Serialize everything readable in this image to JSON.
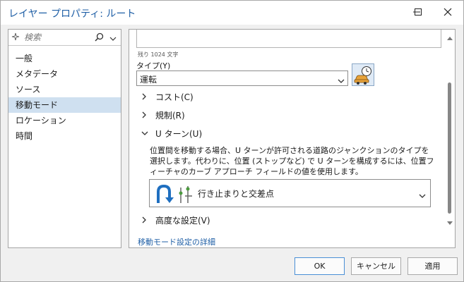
{
  "window": {
    "title": "レイヤー プロパティ: ルート"
  },
  "sidebar": {
    "search_placeholder": "検索",
    "items": [
      {
        "label": "一般",
        "selected": false
      },
      {
        "label": "メタデータ",
        "selected": false
      },
      {
        "label": "ソース",
        "selected": false
      },
      {
        "label": "移動モード",
        "selected": true
      },
      {
        "label": "ロケーション",
        "selected": false
      },
      {
        "label": "時間",
        "selected": false
      }
    ]
  },
  "content": {
    "remaining_text": "残り 1024 文字",
    "type_label": "タイプ(Y)",
    "type_value": "運転",
    "sections": {
      "cost": "コスト(C)",
      "restrictions": "規制(R)",
      "uturn": "U ターン(U)",
      "advanced": "高度な設定(V)"
    },
    "uturn_description": "位置間を移動する場合、U ターンが許可される道路のジャンクションのタイプを選択します。代わりに、位置 (ストップなど) で U ターンを構成するには、位置フィーチャのカーブ アプローチ フィールドの値を使用します。",
    "uturn_value": "行き止まりと交差点",
    "details_link": "移動モード設定の詳細"
  },
  "buttons": {
    "ok": "OK",
    "cancel": "キャンセル",
    "apply": "適用"
  },
  "colors": {
    "accent": "#1f5fa6",
    "selected_row": "#cfe0f0",
    "uturn_blue": "#1f6fc0",
    "uturn_green": "#4c9a3f"
  }
}
